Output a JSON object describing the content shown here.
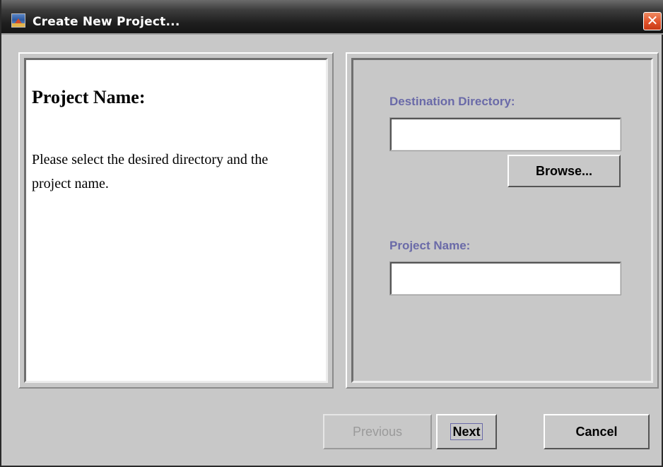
{
  "window": {
    "title": "Create New Project...",
    "close_symbol": "✕"
  },
  "description": {
    "heading": "Project Name:",
    "body": "Please select the desired directory and the project name."
  },
  "form": {
    "destination_label": "Destination Directory:",
    "destination_value": "",
    "browse_label": "Browse...",
    "project_label": "Project Name:",
    "project_value": ""
  },
  "buttons": {
    "previous": "Previous",
    "next": "Next",
    "cancel": "Cancel",
    "previous_enabled": false
  },
  "icons": {
    "app": "app-logo-icon",
    "close": "close-icon"
  },
  "colors": {
    "label_text": "#6a6aa8",
    "close_button": "#e0522a",
    "window_background": "#c8c8c8"
  }
}
